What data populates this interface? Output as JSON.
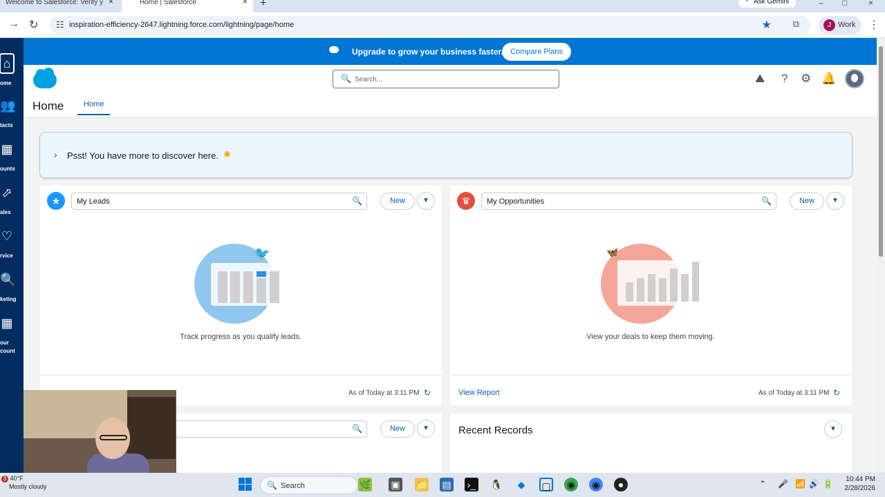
{
  "browser": {
    "tabs": [
      {
        "title": "Welcome to Salesforce: Verify y"
      },
      {
        "title": "Home | Salesforce"
      }
    ],
    "new_tab": "+",
    "ask_gemini": "Ask Gemini",
    "url": "inspiration-efficiency-2647.lightning.force.com/lightning/page/home",
    "profile_initial": "J",
    "profile_label": "Work"
  },
  "left_nav": [
    {
      "label": "ome",
      "icon": "home-icon"
    },
    {
      "label": "tacts",
      "icon": "contacts-icon"
    },
    {
      "label": "ounts",
      "icon": "accounts-icon"
    },
    {
      "label": "ales",
      "icon": "sales-icon"
    },
    {
      "label": "rvice",
      "icon": "service-icon"
    },
    {
      "label": "keting",
      "icon": "marketing-icon"
    },
    {
      "label": "our\ncount",
      "icon": "your-account-icon"
    }
  ],
  "promo": {
    "text": "Upgrade to grow your business faster.",
    "button": "Compare Plans"
  },
  "header": {
    "search_placeholder": "Search..."
  },
  "app_nav": {
    "app_name": "Home",
    "tab": "Home"
  },
  "psst": {
    "text": "Psst! You have more to discover here."
  },
  "leads_card": {
    "list_view": "My Leads",
    "new_button": "New",
    "caption": "Track progress as you qualify leads.",
    "as_of": "As of Today at 3:11 PM"
  },
  "opps_card": {
    "list_view": "My Opportunities",
    "new_button": "New",
    "caption": "View your deals to keep them moving.",
    "view_report": "View Report",
    "as_of": "As of Today at 3:11 PM"
  },
  "third_card": {
    "new_button": "New"
  },
  "recent_records": {
    "title": "Recent Records"
  },
  "taskbar": {
    "weather_badge": "3",
    "temperature": "40°F",
    "weather": "Mostly cloudy",
    "search_placeholder": "Search",
    "time": "10:44 PM",
    "date": "2/28/2026"
  },
  "colors": {
    "brand_blue": "#0176d3",
    "nav_dark": "#032d60",
    "leads_icon": "#1b96ff",
    "opps_icon": "#e3513c"
  }
}
